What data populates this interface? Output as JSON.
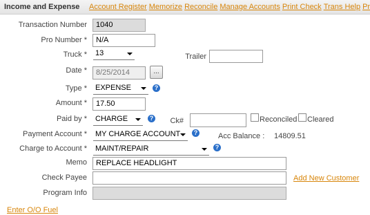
{
  "header": {
    "title": "Income and Expense",
    "links": [
      "Account Register",
      "Memorize",
      "Reconcile",
      "Manage Accounts",
      "Print Check",
      "Trans Help",
      "Pro"
    ]
  },
  "form": {
    "transaction_number": {
      "label": "Transaction Number",
      "value": "1040"
    },
    "pro_number": {
      "label": "Pro Number *",
      "value": "N/A"
    },
    "truck": {
      "label": "Truck *",
      "value": "13"
    },
    "trailer": {
      "label": "Trailer",
      "value": ""
    },
    "date": {
      "label": "Date *",
      "value": "8/25/2014",
      "button": "..."
    },
    "type": {
      "label": "Type *",
      "value": "EXPENSE"
    },
    "amount": {
      "label": "Amount *",
      "value": "17.50"
    },
    "paid_by": {
      "label": "Paid by *",
      "value": "CHARGE"
    },
    "ck": {
      "label": "Ck#",
      "value": ""
    },
    "reconciled": {
      "label": "Reconciled"
    },
    "cleared": {
      "label": "Cleared"
    },
    "payment_account": {
      "label": "Payment Account *",
      "value": "MY CHARGE ACCOUNT"
    },
    "acc_balance": {
      "label": "Acc Balance :",
      "value": "14809.51"
    },
    "charge_to_account": {
      "label": "Charge to Account *",
      "value": "MAINT/REPAIR"
    },
    "memo": {
      "label": "Memo",
      "value": "REPLACE HEADLIGHT"
    },
    "check_payee": {
      "label": "Check Payee",
      "value": ""
    },
    "add_new_customer": "Add New Customer",
    "program_info": {
      "label": "Program Info",
      "value": ""
    }
  },
  "footer": {
    "enter_oo_fuel": "Enter O/O Fuel"
  },
  "help_icon": "question-mark-icon"
}
